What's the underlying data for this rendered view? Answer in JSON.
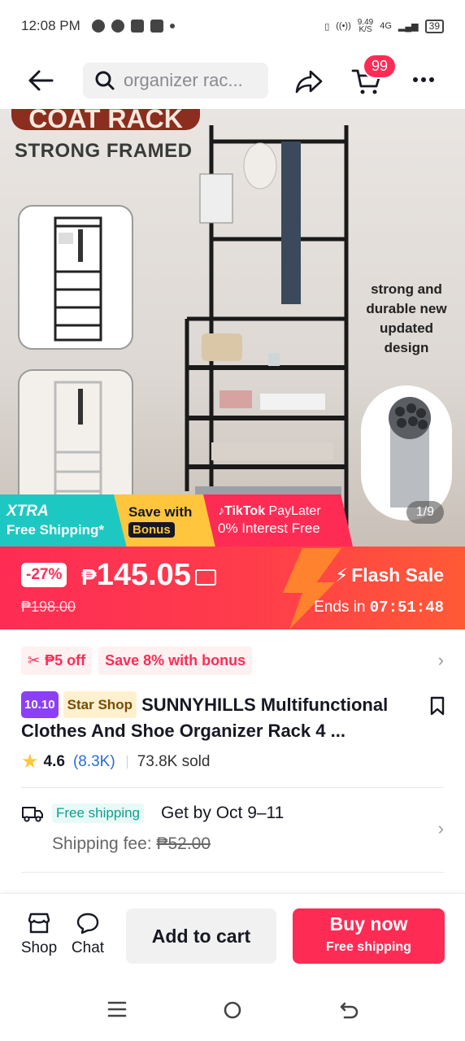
{
  "status_bar": {
    "time": "12:08 PM",
    "speed": "9.49",
    "speed_unit": "K/S",
    "network": "4G",
    "battery": "39"
  },
  "header": {
    "search_placeholder": "organizer rac...",
    "cart_count": "99"
  },
  "hero": {
    "banner_title": "COAT RACK",
    "subtitle": "STRONG FRAMED",
    "caption": "strong and durable new updated design",
    "page_indicator": "1/9"
  },
  "promos": {
    "xtra": "XTRA",
    "free_shipping": "Free Shipping*",
    "save_with": "Save with",
    "bonus": "Bonus",
    "tiktok": "TikTok",
    "paylater": "PayLater",
    "interest": "0% Interest Free"
  },
  "flash_sale": {
    "discount": "-27%",
    "currency": "₱",
    "price": "145.05",
    "original_price": "₱198.00",
    "label": "Flash Sale",
    "ends_label": "Ends in",
    "countdown": "07:51:48"
  },
  "coupons": {
    "items": [
      "₱5 off",
      "Save 8% with bonus"
    ]
  },
  "product": {
    "tag_event": "10.10",
    "tag_shop": "Star Shop",
    "title_line1": "SUNNYHILLS Multifunctional",
    "title_line2": "Clothes And Shoe Organizer Rack 4 ...",
    "rating": "4.6",
    "reviews": "(8.3K)",
    "sold": "73.8K sold"
  },
  "shipping": {
    "badge": "Free shipping",
    "get_by": "Get by Oct 9–11",
    "fee_label": "Shipping fee:",
    "fee_original": "₱52.00"
  },
  "bottom_bar": {
    "shop": "Shop",
    "chat": "Chat",
    "add_to_cart": "Add to cart",
    "buy_now": "Buy now",
    "buy_now_sub": "Free shipping"
  },
  "colors": {
    "accent": "#fe2c55",
    "flash_gradient_end": "#ff5a36",
    "teal": "#1dc8c2",
    "yellow": "#ffc53d"
  }
}
